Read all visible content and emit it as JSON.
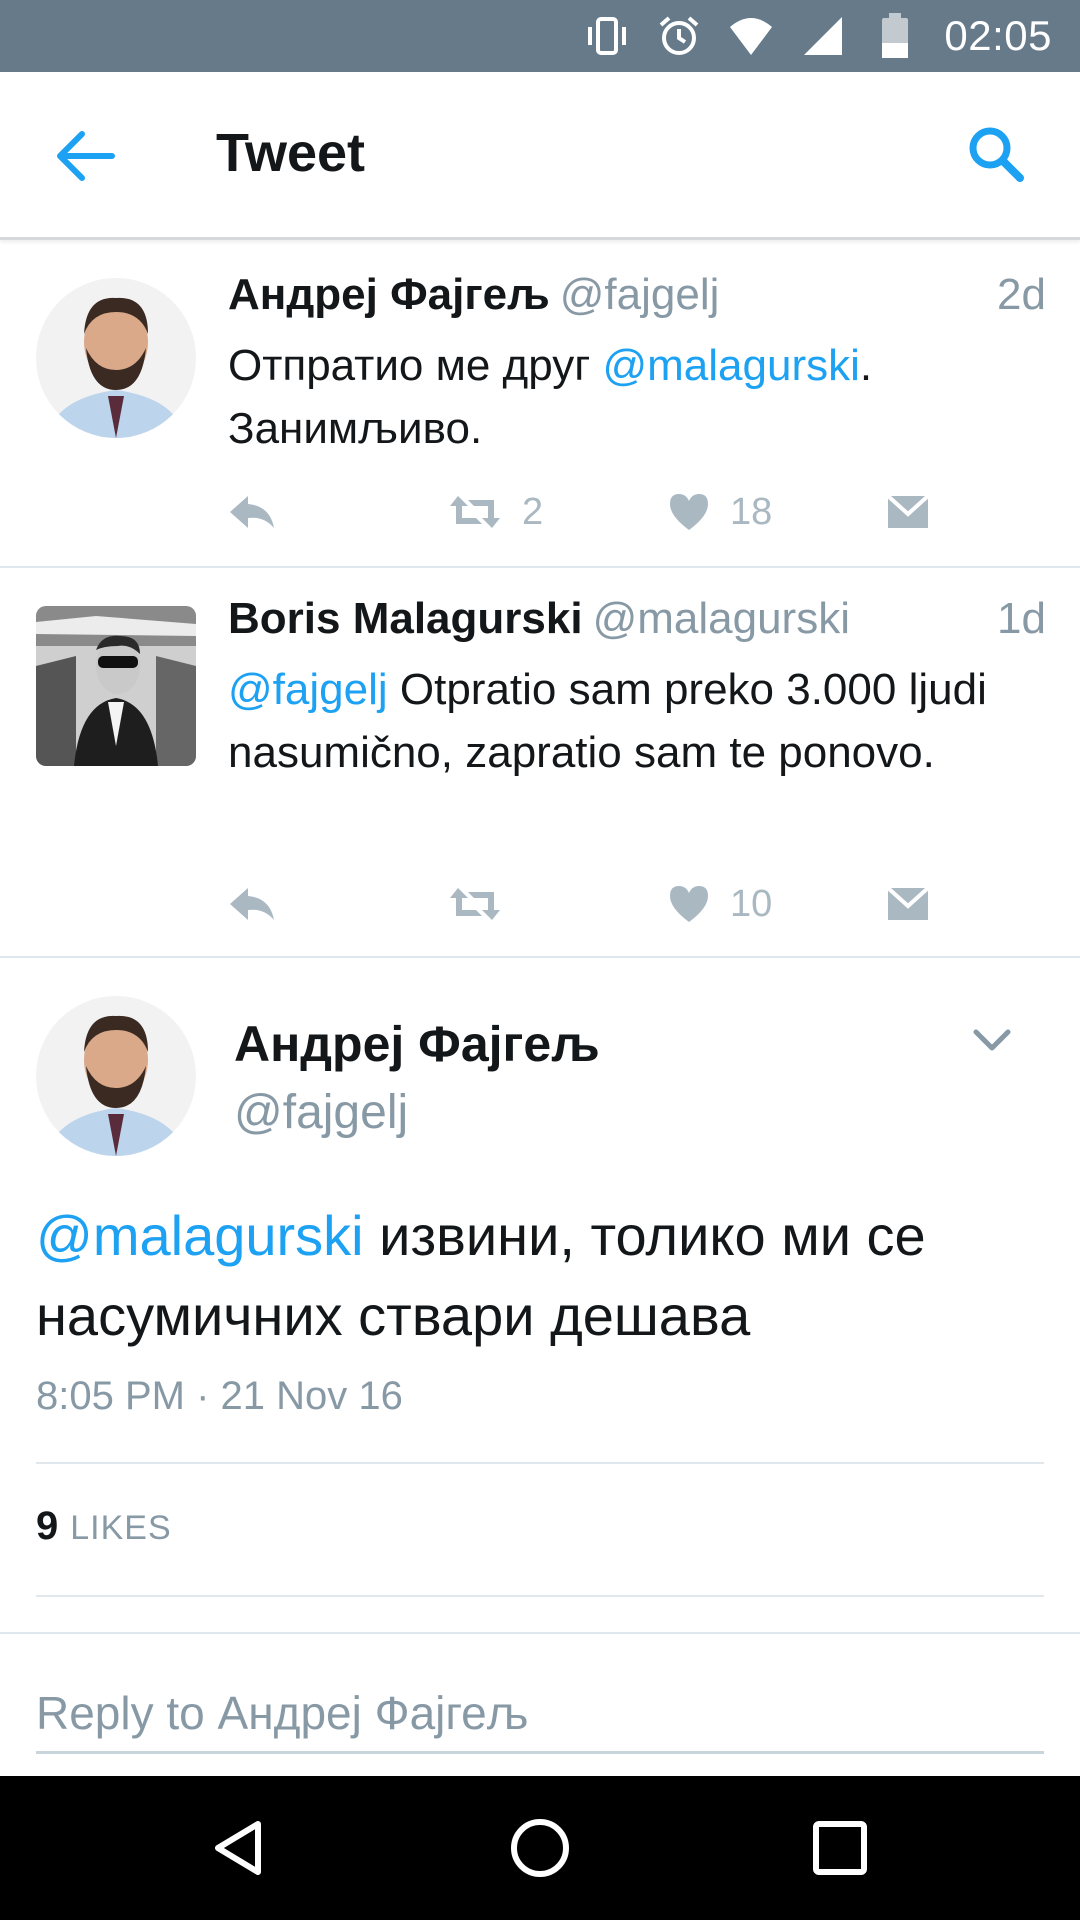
{
  "status_bar": {
    "time": "02:05",
    "icons": [
      "vibrate-icon",
      "alarm-icon",
      "wifi-icon",
      "signal-icon",
      "battery-icon"
    ],
    "background": "#667a8a"
  },
  "app_bar": {
    "title": "Tweet",
    "back_icon": "arrow-left-icon",
    "search_icon": "search-icon",
    "accent": "#1da1f2"
  },
  "tweets": [
    {
      "name": "Андреј Фајгељ",
      "handle": "@fajgelj",
      "age": "2d",
      "text_pre": "Отпратио ме друг ",
      "mention": "@malagurski",
      "text_post": ". Занимљиво.",
      "retweets": "2",
      "likes": "18"
    },
    {
      "name": "Boris Malagurski",
      "handle": "@malagurski",
      "age": "1d",
      "mention": "@fajgelj",
      "text_post": " Otpratio sam preko 3.000 ljudi nasumično, zapratio sam te ponovo.",
      "retweets": "",
      "likes": "10"
    }
  ],
  "main_tweet": {
    "name": "Андреј Фајгељ",
    "handle": "@fajgelj",
    "mention": "@malagurski",
    "text_post": " извини, толико ми се насумичних ствари дешава",
    "timestamp": "8:05 PM · 21 Nov 16",
    "likes_count": "9",
    "likes_label": "LIKES"
  },
  "reply": {
    "placeholder": "Reply to Андреј Фајгељ"
  },
  "nav_bar": {
    "icons": [
      "back-triangle-icon",
      "home-circle-icon",
      "recents-square-icon"
    ]
  }
}
